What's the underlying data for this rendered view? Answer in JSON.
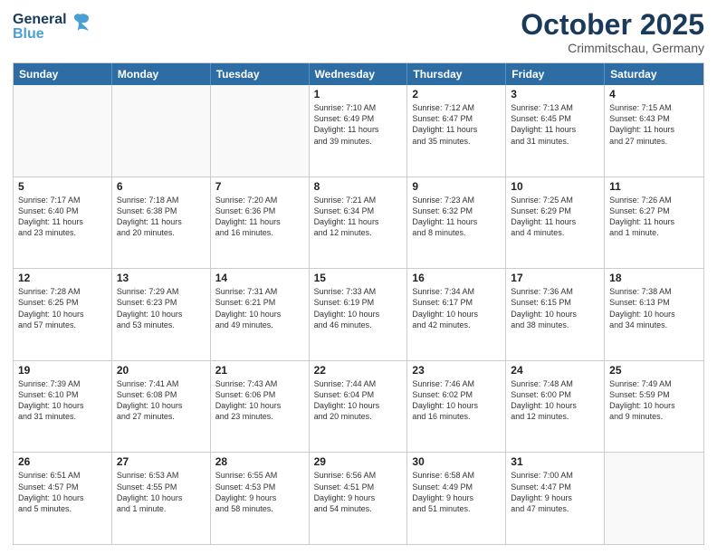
{
  "header": {
    "logo_general": "General",
    "logo_blue": "Blue",
    "title": "October 2025",
    "subtitle": "Crimmitschau, Germany"
  },
  "days": [
    "Sunday",
    "Monday",
    "Tuesday",
    "Wednesday",
    "Thursday",
    "Friday",
    "Saturday"
  ],
  "weeks": [
    [
      {
        "num": "",
        "info": "",
        "empty": true
      },
      {
        "num": "",
        "info": "",
        "empty": true
      },
      {
        "num": "",
        "info": "",
        "empty": true
      },
      {
        "num": "1",
        "info": "Sunrise: 7:10 AM\nSunset: 6:49 PM\nDaylight: 11 hours\nand 39 minutes.",
        "empty": false
      },
      {
        "num": "2",
        "info": "Sunrise: 7:12 AM\nSunset: 6:47 PM\nDaylight: 11 hours\nand 35 minutes.",
        "empty": false
      },
      {
        "num": "3",
        "info": "Sunrise: 7:13 AM\nSunset: 6:45 PM\nDaylight: 11 hours\nand 31 minutes.",
        "empty": false
      },
      {
        "num": "4",
        "info": "Sunrise: 7:15 AM\nSunset: 6:43 PM\nDaylight: 11 hours\nand 27 minutes.",
        "empty": false
      }
    ],
    [
      {
        "num": "5",
        "info": "Sunrise: 7:17 AM\nSunset: 6:40 PM\nDaylight: 11 hours\nand 23 minutes.",
        "empty": false
      },
      {
        "num": "6",
        "info": "Sunrise: 7:18 AM\nSunset: 6:38 PM\nDaylight: 11 hours\nand 20 minutes.",
        "empty": false
      },
      {
        "num": "7",
        "info": "Sunrise: 7:20 AM\nSunset: 6:36 PM\nDaylight: 11 hours\nand 16 minutes.",
        "empty": false
      },
      {
        "num": "8",
        "info": "Sunrise: 7:21 AM\nSunset: 6:34 PM\nDaylight: 11 hours\nand 12 minutes.",
        "empty": false
      },
      {
        "num": "9",
        "info": "Sunrise: 7:23 AM\nSunset: 6:32 PM\nDaylight: 11 hours\nand 8 minutes.",
        "empty": false
      },
      {
        "num": "10",
        "info": "Sunrise: 7:25 AM\nSunset: 6:29 PM\nDaylight: 11 hours\nand 4 minutes.",
        "empty": false
      },
      {
        "num": "11",
        "info": "Sunrise: 7:26 AM\nSunset: 6:27 PM\nDaylight: 11 hours\nand 1 minute.",
        "empty": false
      }
    ],
    [
      {
        "num": "12",
        "info": "Sunrise: 7:28 AM\nSunset: 6:25 PM\nDaylight: 10 hours\nand 57 minutes.",
        "empty": false
      },
      {
        "num": "13",
        "info": "Sunrise: 7:29 AM\nSunset: 6:23 PM\nDaylight: 10 hours\nand 53 minutes.",
        "empty": false
      },
      {
        "num": "14",
        "info": "Sunrise: 7:31 AM\nSunset: 6:21 PM\nDaylight: 10 hours\nand 49 minutes.",
        "empty": false
      },
      {
        "num": "15",
        "info": "Sunrise: 7:33 AM\nSunset: 6:19 PM\nDaylight: 10 hours\nand 46 minutes.",
        "empty": false
      },
      {
        "num": "16",
        "info": "Sunrise: 7:34 AM\nSunset: 6:17 PM\nDaylight: 10 hours\nand 42 minutes.",
        "empty": false
      },
      {
        "num": "17",
        "info": "Sunrise: 7:36 AM\nSunset: 6:15 PM\nDaylight: 10 hours\nand 38 minutes.",
        "empty": false
      },
      {
        "num": "18",
        "info": "Sunrise: 7:38 AM\nSunset: 6:13 PM\nDaylight: 10 hours\nand 34 minutes.",
        "empty": false
      }
    ],
    [
      {
        "num": "19",
        "info": "Sunrise: 7:39 AM\nSunset: 6:10 PM\nDaylight: 10 hours\nand 31 minutes.",
        "empty": false
      },
      {
        "num": "20",
        "info": "Sunrise: 7:41 AM\nSunset: 6:08 PM\nDaylight: 10 hours\nand 27 minutes.",
        "empty": false
      },
      {
        "num": "21",
        "info": "Sunrise: 7:43 AM\nSunset: 6:06 PM\nDaylight: 10 hours\nand 23 minutes.",
        "empty": false
      },
      {
        "num": "22",
        "info": "Sunrise: 7:44 AM\nSunset: 6:04 PM\nDaylight: 10 hours\nand 20 minutes.",
        "empty": false
      },
      {
        "num": "23",
        "info": "Sunrise: 7:46 AM\nSunset: 6:02 PM\nDaylight: 10 hours\nand 16 minutes.",
        "empty": false
      },
      {
        "num": "24",
        "info": "Sunrise: 7:48 AM\nSunset: 6:00 PM\nDaylight: 10 hours\nand 12 minutes.",
        "empty": false
      },
      {
        "num": "25",
        "info": "Sunrise: 7:49 AM\nSunset: 5:59 PM\nDaylight: 10 hours\nand 9 minutes.",
        "empty": false
      }
    ],
    [
      {
        "num": "26",
        "info": "Sunrise: 6:51 AM\nSunset: 4:57 PM\nDaylight: 10 hours\nand 5 minutes.",
        "empty": false
      },
      {
        "num": "27",
        "info": "Sunrise: 6:53 AM\nSunset: 4:55 PM\nDaylight: 10 hours\nand 1 minute.",
        "empty": false
      },
      {
        "num": "28",
        "info": "Sunrise: 6:55 AM\nSunset: 4:53 PM\nDaylight: 9 hours\nand 58 minutes.",
        "empty": false
      },
      {
        "num": "29",
        "info": "Sunrise: 6:56 AM\nSunset: 4:51 PM\nDaylight: 9 hours\nand 54 minutes.",
        "empty": false
      },
      {
        "num": "30",
        "info": "Sunrise: 6:58 AM\nSunset: 4:49 PM\nDaylight: 9 hours\nand 51 minutes.",
        "empty": false
      },
      {
        "num": "31",
        "info": "Sunrise: 7:00 AM\nSunset: 4:47 PM\nDaylight: 9 hours\nand 47 minutes.",
        "empty": false
      },
      {
        "num": "",
        "info": "",
        "empty": true
      }
    ]
  ]
}
